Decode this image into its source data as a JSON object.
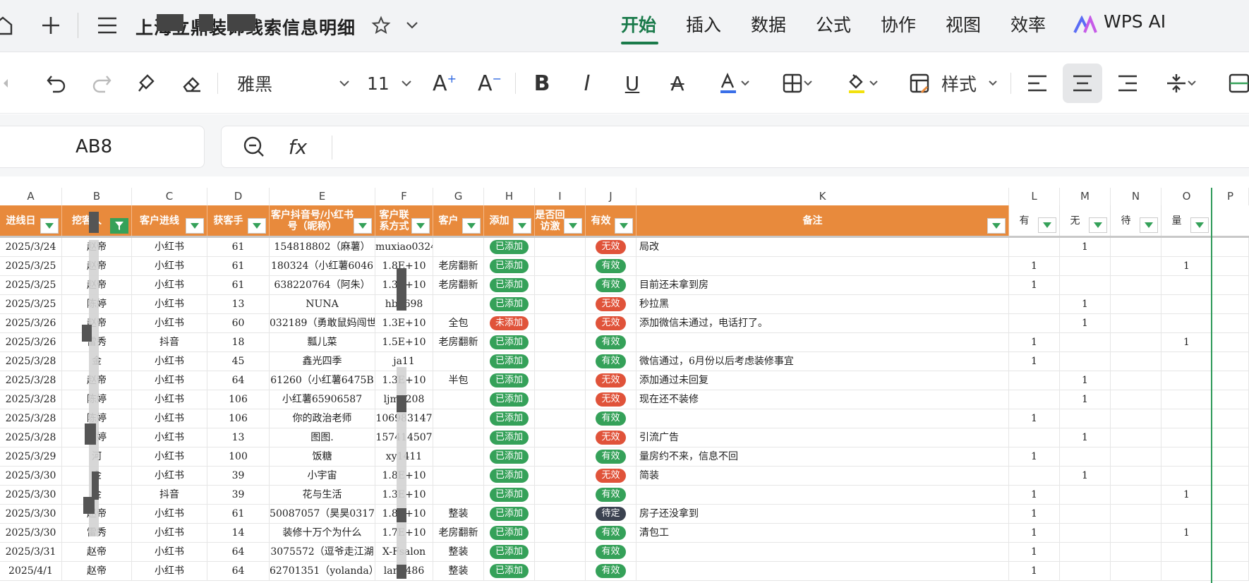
{
  "titlebar": {
    "doc_title": "上海立鼎装饰线索信息明细",
    "menus": [
      "开始",
      "插入",
      "数据",
      "公式",
      "协作",
      "视图",
      "效率",
      "WPS AI"
    ],
    "active_menu": "开始"
  },
  "toolbar": {
    "font_name": "雅黑",
    "font_size": "11",
    "style_label": "样式"
  },
  "formula": {
    "cell_ref": "AB8",
    "fx": "fx"
  },
  "columns": [
    "A",
    "B",
    "C",
    "D",
    "E",
    "F",
    "G",
    "H",
    "I",
    "J",
    "K",
    "L",
    "M",
    "N",
    "O",
    "P"
  ],
  "headers": {
    "A": "进线日",
    "B": "挖客人",
    "C": "客户进线",
    "D": "获客手",
    "E": "客户抖音号/小红书号（昵称）",
    "F": "客户联系方式",
    "G": "客户",
    "H": "添加",
    "I": "是否回访激",
    "J": "有效",
    "K": "备注",
    "L": "有",
    "M": "无",
    "N": "待",
    "O": "量"
  },
  "rows": [
    {
      "A": "2025/3/24",
      "B": "赵帝",
      "C": "小红书",
      "D": "61",
      "E": "154818802（麻薯）",
      "F": "muxiao0324",
      "G": "",
      "H": "已添加",
      "J": "无效",
      "K": "局改",
      "L": "",
      "M": "1",
      "O": ""
    },
    {
      "A": "2025/3/25",
      "B": "赵帝",
      "C": "小红书",
      "D": "61",
      "E": "180324（小红薯6046",
      "F": "1.8E+10",
      "G": "老房翻新",
      "H": "已添加",
      "J": "有效",
      "K": "",
      "L": "1",
      "M": "",
      "O": "1"
    },
    {
      "A": "2025/3/25",
      "B": "赵帝",
      "C": "小红书",
      "D": "61",
      "E": "638220764（阿朱）",
      "F": "1.3E+10",
      "G": "老房翻新",
      "H": "已添加",
      "J": "有效",
      "K": "目前还未拿到房",
      "L": "1",
      "M": "",
      "O": ""
    },
    {
      "A": "2025/3/25",
      "B": "陈婷",
      "C": "小红书",
      "D": "13",
      "E": "NUNA",
      "F": "hb2698",
      "G": "",
      "H": "已添加",
      "J": "无效",
      "K": "秒拉黑",
      "L": "",
      "M": "1",
      "O": ""
    },
    {
      "A": "2025/3/26",
      "B": "赵帝",
      "C": "小红书",
      "D": "60",
      "E": "032189（勇敢鼠妈闯世",
      "F": "1.3E+10",
      "G": "全包",
      "H": "未添加",
      "J": "无效",
      "K": "添加微信未通过，电话打了。",
      "L": "",
      "M": "1",
      "O": ""
    },
    {
      "A": "2025/3/26",
      "B": "雷秀",
      "C": "抖音",
      "D": "18",
      "E": "瓢儿菜",
      "F": "1.5E+10",
      "G": "老房翻新",
      "H": "已添加",
      "J": "有效",
      "K": "",
      "L": "1",
      "M": "",
      "O": "1"
    },
    {
      "A": "2025/3/28",
      "B": "金",
      "C": "小红书",
      "D": "45",
      "E": "鑫光四季",
      "F": "ja11",
      "G": "",
      "H": "已添加",
      "J": "有效",
      "K": "微信通过，6月份以后考虑装修事宜",
      "L": "1",
      "M": "",
      "O": ""
    },
    {
      "A": "2025/3/28",
      "B": "赵帝",
      "C": "小红书",
      "D": "64",
      "E": "61260（小红薯6475B",
      "F": "1.3E+10",
      "G": "半包",
      "H": "已添加",
      "J": "无效",
      "K": "添加通过未回复",
      "L": "",
      "M": "1",
      "O": ""
    },
    {
      "A": "2025/3/28",
      "B": "陈婷",
      "C": "小红书",
      "D": "106",
      "E": "小红薯65906587",
      "F": "ljm0208",
      "G": "",
      "H": "已添加",
      "J": "无效",
      "K": "现在还不装修",
      "L": "",
      "M": "1",
      "O": ""
    },
    {
      "A": "2025/3/28",
      "B": "陈婷",
      "C": "小红书",
      "D": "106",
      "E": "你的政治老师",
      "F": "106983147",
      "G": "",
      "H": "已添加",
      "J": "有效",
      "K": "",
      "L": "1",
      "M": "",
      "O": ""
    },
    {
      "A": "2025/3/28",
      "B": "陈婷",
      "C": "小红书",
      "D": "13",
      "E": "图图.",
      "F": "157414507",
      "G": "",
      "H": "已添加",
      "J": "无效",
      "K": "引流广告",
      "L": "",
      "M": "1",
      "O": ""
    },
    {
      "A": "2025/3/29",
      "B": "河",
      "C": "小红书",
      "D": "100",
      "E": "饭糖",
      "F": "xy1411",
      "G": "",
      "H": "已添加",
      "J": "有效",
      "K": "量房约不来，信息不回",
      "L": "1",
      "M": "",
      "O": ""
    },
    {
      "A": "2025/3/30",
      "B": "金",
      "C": "小红书",
      "D": "39",
      "E": "小宇宙",
      "F": "1.8E+10",
      "G": "",
      "H": "已添加",
      "J": "无效",
      "K": "简装",
      "L": "",
      "M": "1",
      "O": ""
    },
    {
      "A": "2025/3/30",
      "B": "金",
      "C": "抖音",
      "D": "39",
      "E": "花与生活",
      "F": "1.3E+10",
      "G": "",
      "H": "已添加",
      "J": "有效",
      "K": "",
      "L": "1",
      "M": "",
      "O": "1"
    },
    {
      "A": "2025/3/30",
      "B": "赵帝",
      "C": "小红书",
      "D": "61",
      "E": "50087057（昊昊0317",
      "F": "1.8E+10",
      "G": "整装",
      "H": "已添加",
      "J": "待定",
      "K": "房子还没拿到",
      "L": "1",
      "M": "",
      "O": ""
    },
    {
      "A": "2025/3/30",
      "B": "雷秀",
      "C": "小红书",
      "D": "14",
      "E": "装修十万个为什么",
      "F": "1.7E+10",
      "G": "老房翻新",
      "H": "已添加",
      "J": "有效",
      "K": "清包工",
      "L": "1",
      "M": "",
      "O": "1"
    },
    {
      "A": "2025/3/31",
      "B": "赵帝",
      "C": "小红书",
      "D": "64",
      "E": "3075572（逗爷走江湖",
      "F": "X-Fsalon",
      "G": "整装",
      "H": "已添加",
      "J": "有效",
      "K": "",
      "L": "1",
      "M": "",
      "O": ""
    },
    {
      "A": "2025/4/1",
      "B": "赵帝",
      "C": "小红书",
      "D": "64",
      "E": "62701351（yolanda）",
      "F": "lan4486",
      "G": "整装",
      "H": "已添加",
      "J": "有效",
      "K": "",
      "L": "1",
      "M": "",
      "O": ""
    }
  ],
  "colors": {
    "accent": "#1a7a4a",
    "header": "#e88a3c",
    "valid": "#35a159",
    "invalid": "#e0533a",
    "pending": "#3b4250"
  }
}
